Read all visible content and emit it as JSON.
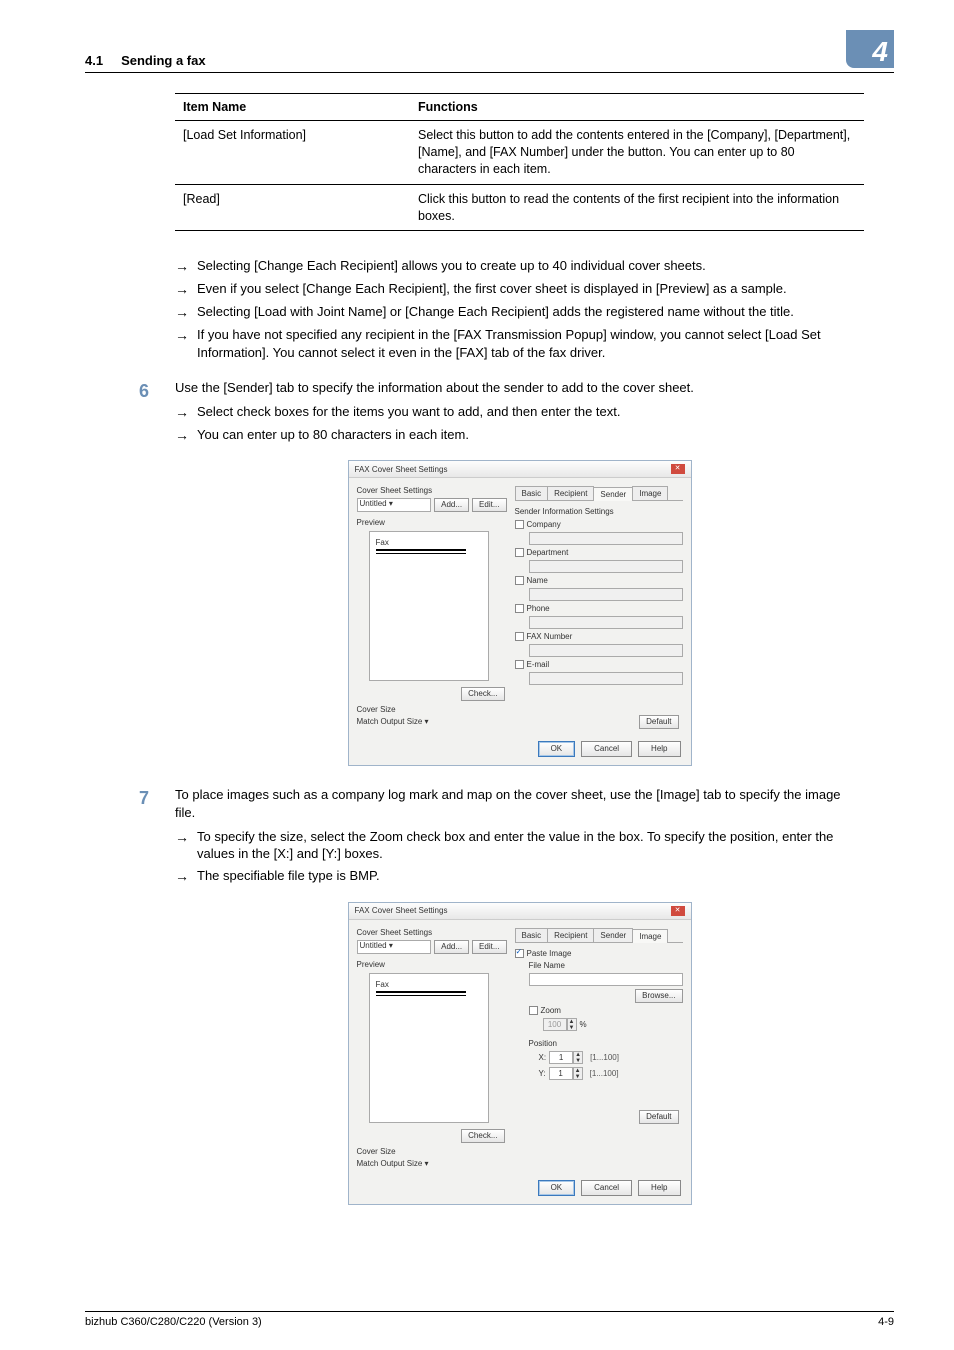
{
  "header": {
    "section_number": "4.1",
    "section_title": "Sending a fax",
    "chapter_badge": "4"
  },
  "table": {
    "headers": [
      "Item Name",
      "Functions"
    ],
    "rows": [
      {
        "name": "[Load Set Information]",
        "desc": "Select this button to add the contents entered in the [Company], [Department], [Name], and [FAX Number] under the button. You can enter up to 80 characters in each item."
      },
      {
        "name": "[Read]",
        "desc": "Click this button to read the contents of the first recipient into the information boxes."
      }
    ]
  },
  "notes_after_table": [
    "Selecting [Change Each Recipient] allows you to create up to 40 individual cover sheets.",
    "Even if you select [Change Each Recipient], the first cover sheet is displayed in [Preview] as a sample.",
    "Selecting [Load with Joint Name] or [Change Each Recipient] adds the registered name without the title.",
    "If you have not specified any recipient in the [FAX Transmission Popup] window, you cannot select [Load Set Information]. You cannot select it even in the [FAX] tab of the fax driver."
  ],
  "step6": {
    "num": "6",
    "text": "Use the [Sender] tab to specify the information about the sender to add to the cover sheet.",
    "subs": [
      "Select check boxes for the items you want to add, and then enter the text.",
      "You can enter up to 80 characters in each item."
    ]
  },
  "step7": {
    "num": "7",
    "text": "To place images such as a company log mark and map on the cover sheet, use the [Image] tab to specify the image file.",
    "subs": [
      "To specify the size, select the Zoom check box and enter the value in the box. To specify the position, enter the values in the [X:] and [Y:] boxes.",
      "The specifiable file type is BMP."
    ]
  },
  "dialog_common": {
    "title": "FAX Cover Sheet Settings",
    "cover_sheet_settings": "Cover Sheet Settings",
    "untitled": "Untitled",
    "add": "Add...",
    "edit": "Edit...",
    "preview": "Preview",
    "fax": "Fax",
    "check": "Check...",
    "cover_size": "Cover Size",
    "match_output": "Match Output Size",
    "default": "Default",
    "ok": "OK",
    "cancel": "Cancel",
    "help": "Help",
    "tabs": {
      "basic": "Basic",
      "recipient": "Recipient",
      "sender": "Sender",
      "image": "Image"
    }
  },
  "dialog1": {
    "group": "Sender Information Settings",
    "fields": [
      "Company",
      "Department",
      "Name",
      "Phone",
      "FAX Number",
      "E-mail"
    ]
  },
  "dialog2": {
    "paste_image": "Paste Image",
    "file_name": "File Name",
    "browse": "Browse...",
    "zoom": "Zoom",
    "zoom_val": "100",
    "zoom_unit": "%",
    "position": "Position",
    "x_label": "X:",
    "y_label": "Y:",
    "x_val": "1",
    "y_val": "1",
    "range": "[1...100]"
  },
  "footer": {
    "left": "bizhub C360/C280/C220 (Version 3)",
    "right": "4-9"
  },
  "arrow_glyph": "→"
}
